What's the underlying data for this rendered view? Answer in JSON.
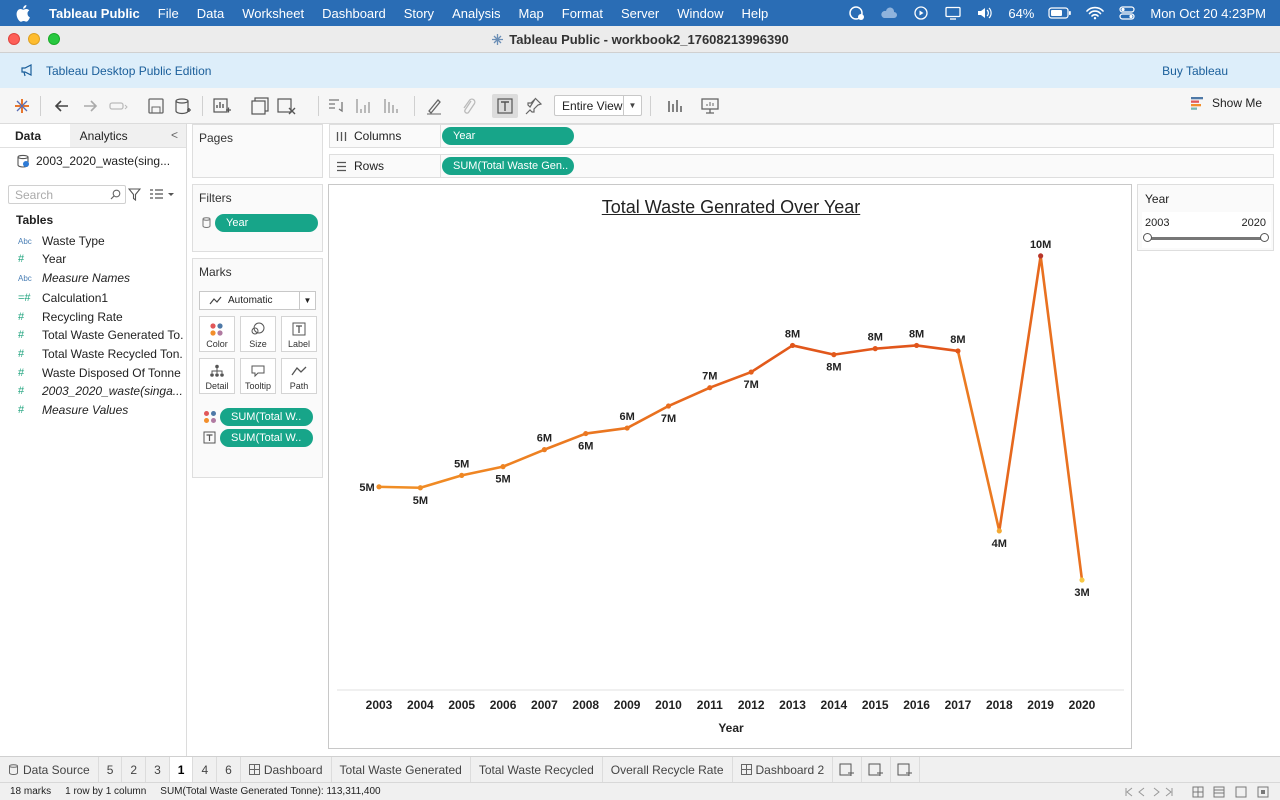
{
  "menubar": {
    "app": "Tableau Public",
    "items": [
      "File",
      "Data",
      "Worksheet",
      "Dashboard",
      "Story",
      "Analysis",
      "Map",
      "Format",
      "Server",
      "Window",
      "Help"
    ],
    "battery": "64%",
    "datetime": "Mon Oct 20  4:23PM"
  },
  "window": {
    "title": "Tableau Public - workbook2_17608213996390"
  },
  "banner": {
    "edition": "Tableau Desktop Public Edition",
    "buy": "Buy Tableau"
  },
  "toolbar": {
    "view_mode": "Entire View",
    "show_me": "Show Me"
  },
  "datapane": {
    "tab_data": "Data",
    "tab_analytics": "Analytics",
    "datasource": "2003_2020_waste(sing...",
    "search_placeholder": "Search",
    "tables_heading": "Tables",
    "fields": [
      {
        "type": "Abc",
        "label": "Waste Type",
        "italic": false
      },
      {
        "type": "#",
        "label": "Year",
        "italic": false
      },
      {
        "type": "Abc",
        "label": "Measure Names",
        "italic": true
      },
      {
        "type": "=#",
        "label": "Calculation1",
        "italic": false
      },
      {
        "type": "#",
        "label": "Recycling Rate",
        "italic": false
      },
      {
        "type": "#",
        "label": "Total Waste Generated To...",
        "italic": false
      },
      {
        "type": "#",
        "label": "Total Waste Recycled Ton...",
        "italic": false
      },
      {
        "type": "#",
        "label": "Waste Disposed Of Tonne",
        "italic": false
      },
      {
        "type": "#",
        "label": "2003_2020_waste(singa...",
        "italic": true
      },
      {
        "type": "#",
        "label": "Measure Values",
        "italic": true
      }
    ]
  },
  "shelves": {
    "pages": "Pages",
    "filters": "Filters",
    "filter_pill": "Year",
    "marks": "Marks",
    "mark_type": "Automatic",
    "mark_buttons": [
      "Color",
      "Size",
      "Label",
      "Detail",
      "Tooltip",
      "Path"
    ],
    "mark_pills": [
      "SUM(Total W..",
      "SUM(Total W.."
    ],
    "columns_label": "Columns",
    "columns_pill": "Year",
    "rows_label": "Rows",
    "rows_pill": "SUM(Total Waste Gen.."
  },
  "yearfilter": {
    "title": "Year",
    "min": "2003",
    "max": "2020"
  },
  "chart_data": {
    "type": "line",
    "title": "Total Waste Genrated Over Year",
    "xlabel": "Year",
    "ylabel": "",
    "categories": [
      "2003",
      "2004",
      "2005",
      "2006",
      "2007",
      "2008",
      "2009",
      "2010",
      "2011",
      "2012",
      "2013",
      "2014",
      "2015",
      "2016",
      "2017",
      "2018",
      "2019",
      "2020"
    ],
    "values": [
      4.97,
      4.95,
      5.22,
      5.41,
      5.78,
      6.13,
      6.25,
      6.73,
      7.13,
      7.47,
      8.05,
      7.85,
      7.98,
      8.05,
      7.93,
      4.01,
      10.0,
      2.94
    ],
    "labels": [
      "5M",
      "5M",
      "5M",
      "5M",
      "6M",
      "6M",
      "6M",
      "7M",
      "7M",
      "7M",
      "8M",
      "8M",
      "8M",
      "8M",
      "8M",
      "4M",
      "10M",
      "3M"
    ],
    "ylim": [
      0,
      11
    ],
    "grid": false,
    "colors": {
      "low": "#f7c844",
      "mid": "#f08a24",
      "high": "#e0521a",
      "top": "#b8362a"
    }
  },
  "sheettabs": {
    "items": [
      "Data Source",
      "5",
      "2",
      "3",
      "1",
      "4",
      "6",
      "Dashboard",
      "Total Waste Generated",
      "Total Waste Recycled",
      "Overall Recycle Rate",
      "Dashboard 2"
    ],
    "active": "1"
  },
  "status": {
    "marks": "18 marks",
    "dims": "1 row by 1 column",
    "sum": "SUM(Total Waste Generated Tonne): 113,311,400"
  }
}
